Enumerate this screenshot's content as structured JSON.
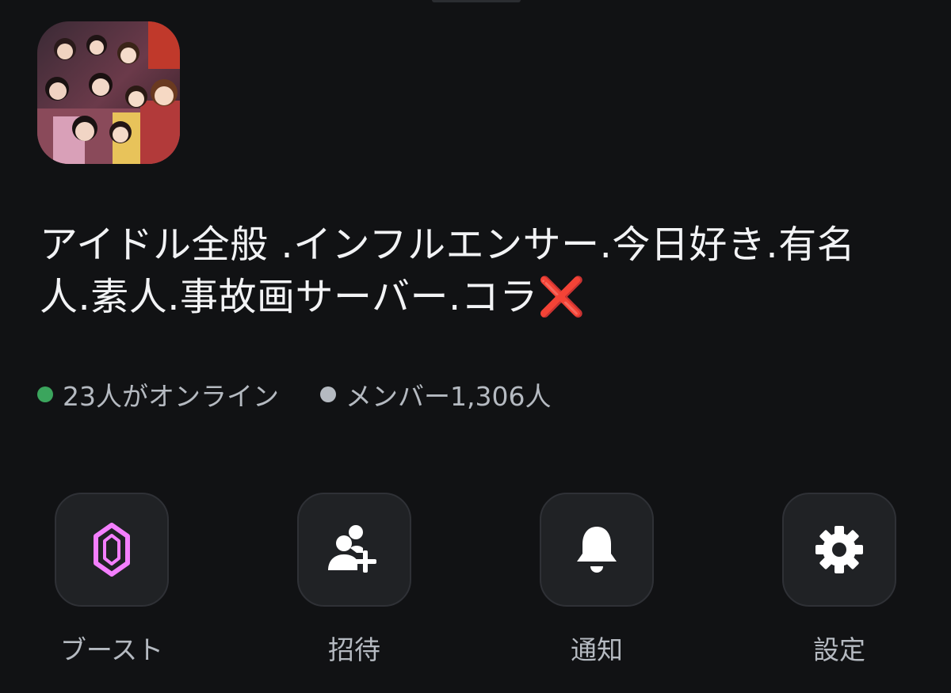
{
  "server": {
    "name": "アイドル全般 .インフルエンサー.今日好き.有名人.素人.事故画サーバー.コラ",
    "name_suffix_emoji": "❌"
  },
  "stats": {
    "online_text": "23人がオンライン",
    "members_text": "メンバー1,306人",
    "online_color": "#3ba55d",
    "members_color": "#b5bac1"
  },
  "actions": [
    {
      "label": "ブースト",
      "icon": "boost-gem-icon",
      "icon_color": "#f47fff"
    },
    {
      "label": "招待",
      "icon": "invite-user-icon",
      "icon_color": "#ffffff"
    },
    {
      "label": "通知",
      "icon": "bell-icon",
      "icon_color": "#ffffff"
    },
    {
      "label": "設定",
      "icon": "gear-icon",
      "icon_color": "#ffffff"
    }
  ]
}
